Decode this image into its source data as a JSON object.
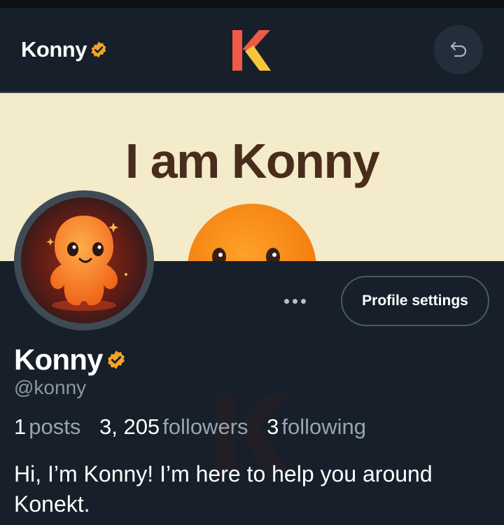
{
  "header": {
    "title": "Konny",
    "verified_icon": "verified-badge-icon",
    "logo_letter": "K",
    "back_icon": "undo-arrow-icon"
  },
  "banner": {
    "text": "I am Konny",
    "background": "#f3ebc9",
    "text_color": "#4a2c1c"
  },
  "profile": {
    "name": "Konny",
    "handle": "@konny",
    "settings_label": "Profile settings",
    "more_icon": "more-dots-icon",
    "stats": [
      {
        "num": "1",
        "label": "posts"
      },
      {
        "num": "3, 205",
        "label": "followers"
      },
      {
        "num": "3",
        "label": "following"
      }
    ],
    "bio": "Hi, I’m Konny! I’m here to help you around Konekt."
  },
  "colors": {
    "background": "#17202a",
    "accent_orange": "#f28a16",
    "badge": "#f5a524",
    "logo_red": "#ef5a45",
    "logo_yellow": "#f7c53b"
  }
}
